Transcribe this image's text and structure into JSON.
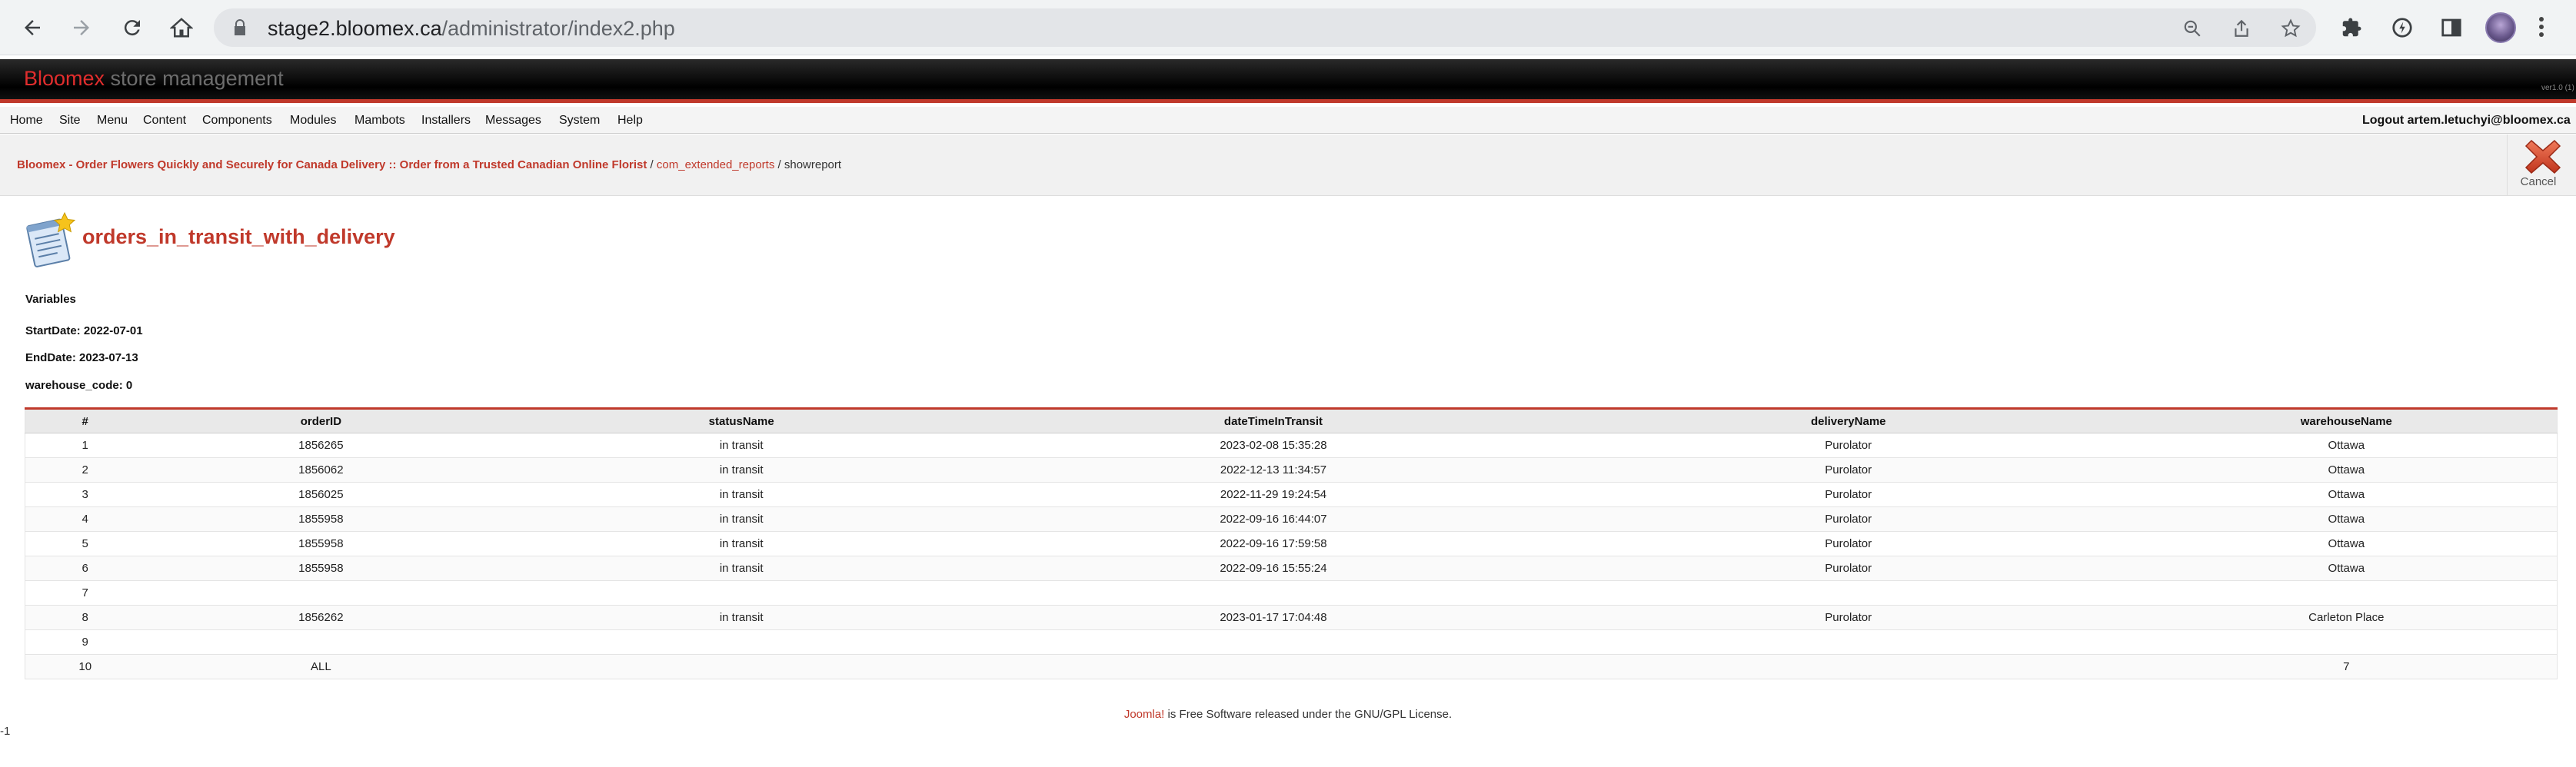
{
  "browser": {
    "url_host": "stage2.bloomex.ca",
    "url_path": "/administrator/index2.php"
  },
  "header": {
    "brand_primary": "Bloomex",
    "brand_secondary": " store management",
    "right_text": "ver1.0 (1)"
  },
  "menu": {
    "items": [
      "Home",
      "Site",
      "Menu",
      "Content",
      "Components",
      "Modules",
      "Mambots",
      "Installers",
      "Messages",
      "System",
      "Help"
    ],
    "logout": "Logout artem.letuchyi@bloomex.ca"
  },
  "breadcrumb": {
    "site": "Bloomex - Order Flowers Quickly and Securely for Canada Delivery :: Order from a Trusted Canadian Online Florist",
    "sep1": " / ",
    "component": "com_extended_reports",
    "sep2": " / ",
    "current": "showreport"
  },
  "toolbar": {
    "cancel_label": "Cancel"
  },
  "report": {
    "title": "orders_in_transit_with_delivery",
    "variables_title": "Variables",
    "variables": [
      "StartDate: 2022-07-01",
      "EndDate: 2023-07-13",
      "warehouse_code: 0"
    ],
    "columns": [
      "#",
      "orderID",
      "statusName",
      "dateTimeInTransit",
      "deliveryName",
      "warehouseName"
    ],
    "rows": [
      [
        "1",
        "1856265",
        "in transit",
        "2023-02-08 15:35:28",
        "Purolator",
        "Ottawa"
      ],
      [
        "2",
        "1856062",
        "in transit",
        "2022-12-13 11:34:57",
        "Purolator",
        "Ottawa"
      ],
      [
        "3",
        "1856025",
        "in transit",
        "2022-11-29 19:24:54",
        "Purolator",
        "Ottawa"
      ],
      [
        "4",
        "1855958",
        "in transit",
        "2022-09-16 16:44:07",
        "Purolator",
        "Ottawa"
      ],
      [
        "5",
        "1855958",
        "in transit",
        "2022-09-16 17:59:58",
        "Purolator",
        "Ottawa"
      ],
      [
        "6",
        "1855958",
        "in transit",
        "2022-09-16 15:55:24",
        "Purolator",
        "Ottawa"
      ],
      [
        "7",
        "",
        "",
        "",
        "",
        ""
      ],
      [
        "8",
        "1856262",
        "in transit",
        "2023-01-17 17:04:48",
        "Purolator",
        "Carleton Place"
      ],
      [
        "9",
        "",
        "",
        "",
        "",
        ""
      ],
      [
        "10",
        "ALL",
        "",
        "",
        "",
        "7"
      ]
    ]
  },
  "footer": {
    "joomla_link": "Joomla!",
    "text": " is Free Software released under the GNU/GPL License.",
    "stray": "-1"
  },
  "colors": {
    "accent": "#c0392b",
    "brand_red": "#e12d2d"
  }
}
